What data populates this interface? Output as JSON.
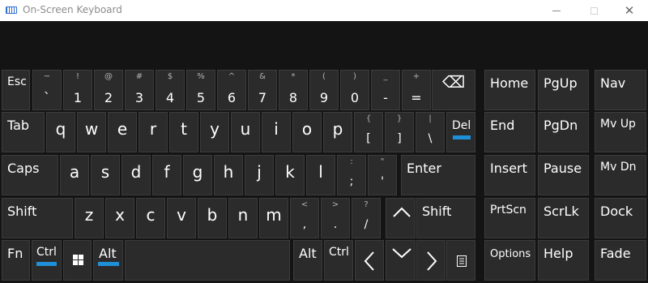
{
  "window": {
    "title": "On-Screen Keyboard",
    "controls": {
      "minimize": "",
      "maximize": "",
      "close": "✕"
    }
  },
  "keys": {
    "esc": "Esc",
    "row1": [
      {
        "top": "~",
        "main": "`"
      },
      {
        "top": "!",
        "main": "1"
      },
      {
        "top": "@",
        "main": "2"
      },
      {
        "top": "#",
        "main": "3"
      },
      {
        "top": "$",
        "main": "4"
      },
      {
        "top": "%",
        "main": "5"
      },
      {
        "top": "^",
        "main": "6"
      },
      {
        "top": "&",
        "main": "7"
      },
      {
        "top": "*",
        "main": "8"
      },
      {
        "top": "(",
        "main": "9"
      },
      {
        "top": ")",
        "main": "0"
      },
      {
        "top": "_",
        "main": "-"
      },
      {
        "top": "+",
        "main": "="
      }
    ],
    "backspace": "⌫",
    "tab": "Tab",
    "row2": [
      "q",
      "w",
      "e",
      "r",
      "t",
      "y",
      "u",
      "i",
      "o",
      "p"
    ],
    "row2_punct": [
      {
        "top": "{",
        "main": "["
      },
      {
        "top": "}",
        "main": "]"
      },
      {
        "top": "|",
        "main": "\\"
      }
    ],
    "del": "Del",
    "caps": "Caps",
    "row3": [
      "a",
      "s",
      "d",
      "f",
      "g",
      "h",
      "j",
      "k",
      "l"
    ],
    "row3_punct": [
      {
        "top": ":",
        "main": ";"
      },
      {
        "top": "\"",
        "main": "'"
      }
    ],
    "enter": "Enter",
    "shift_left": "Shift",
    "row4": [
      "z",
      "x",
      "c",
      "v",
      "b",
      "n",
      "m"
    ],
    "row4_punct": [
      {
        "top": "<",
        "main": ","
      },
      {
        "top": ">",
        "main": "."
      },
      {
        "top": "?",
        "main": "/"
      }
    ],
    "up": "⌃",
    "shift_right": "Shift",
    "fn": "Fn",
    "ctrl_left": "Ctrl",
    "win": "⊞",
    "alt_left": "Alt",
    "alt_right": "Alt",
    "ctrl_right": "Ctrl",
    "left": "〈",
    "down": "⌄",
    "right": "〉",
    "menu": "▤",
    "nav_block": {
      "home": "Home",
      "pgup": "PgUp",
      "nav": "Nav",
      "end": "End",
      "pgdn": "PgDn",
      "mvup": "Mv Up",
      "insert": "Insert",
      "pause": "Pause",
      "mvdn": "Mv Dn",
      "prtscn": "PrtScn",
      "scrlk": "ScrLk",
      "dock": "Dock",
      "options": "Options",
      "help": "Help",
      "fade": "Fade"
    }
  },
  "colors": {
    "accent": "#1f8fd8",
    "key": "#2b2b2b",
    "background": "#141414"
  },
  "icons": {
    "app": "keyboard-icon",
    "backspace": "backspace-icon",
    "windows": "windows-logo-icon",
    "menu": "context-menu-icon"
  }
}
